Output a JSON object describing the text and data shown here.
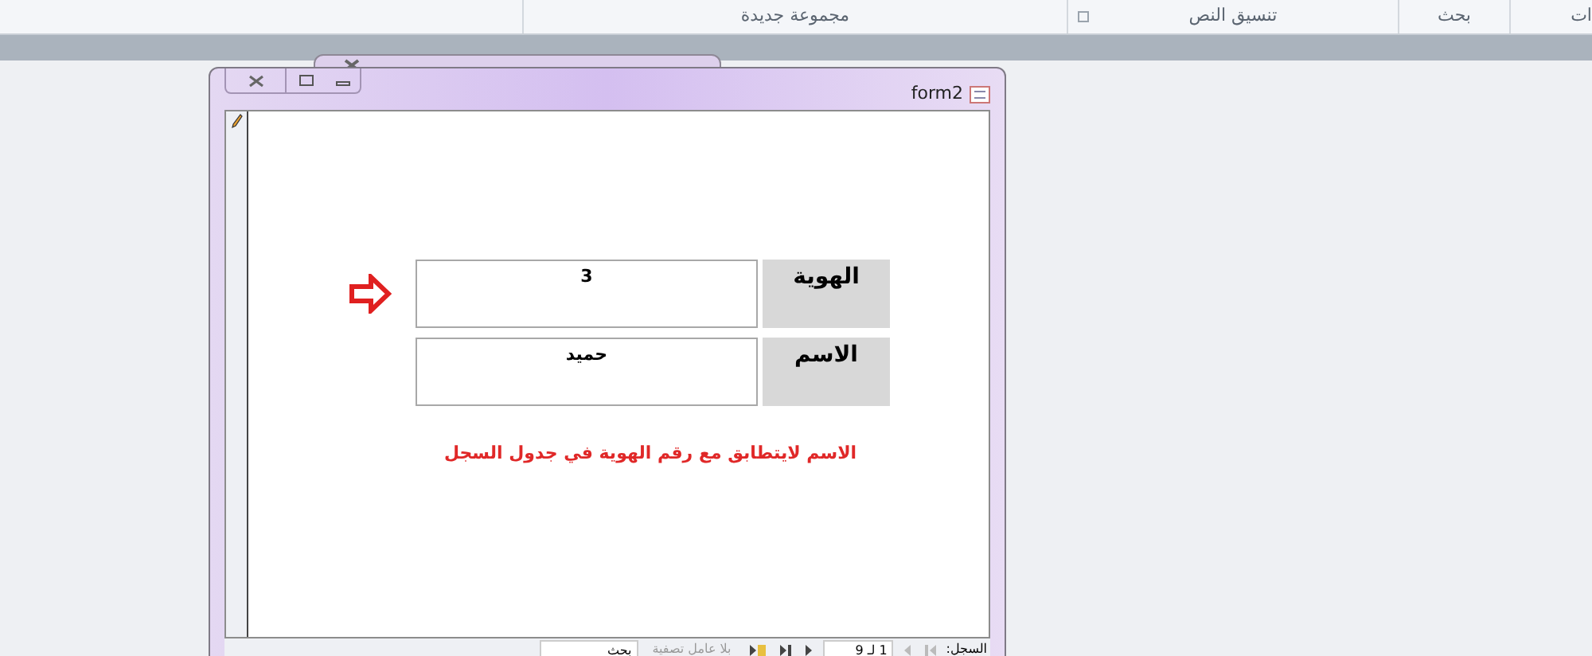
{
  "ribbon": {
    "groups": [
      {
        "label": "ات",
        "launcher": false
      },
      {
        "label": "بحث",
        "launcher": false
      },
      {
        "label": "تنسيق النص",
        "launcher": true
      },
      {
        "label": "مجموعة جديدة",
        "launcher": false
      }
    ]
  },
  "window": {
    "title": "form2"
  },
  "form": {
    "fields": [
      {
        "label": "الهوية",
        "value": "3",
        "current": true
      },
      {
        "label": "الاسم",
        "value": "حميد",
        "current": false
      }
    ],
    "message": "الاسم لايتطابق مع رقم الهوية في جدول السجل"
  },
  "navigation": {
    "label": "السجل:",
    "position": "1 لـ 9",
    "filter": "بلا عامل تصفية",
    "search_placeholder": "بحث"
  }
}
